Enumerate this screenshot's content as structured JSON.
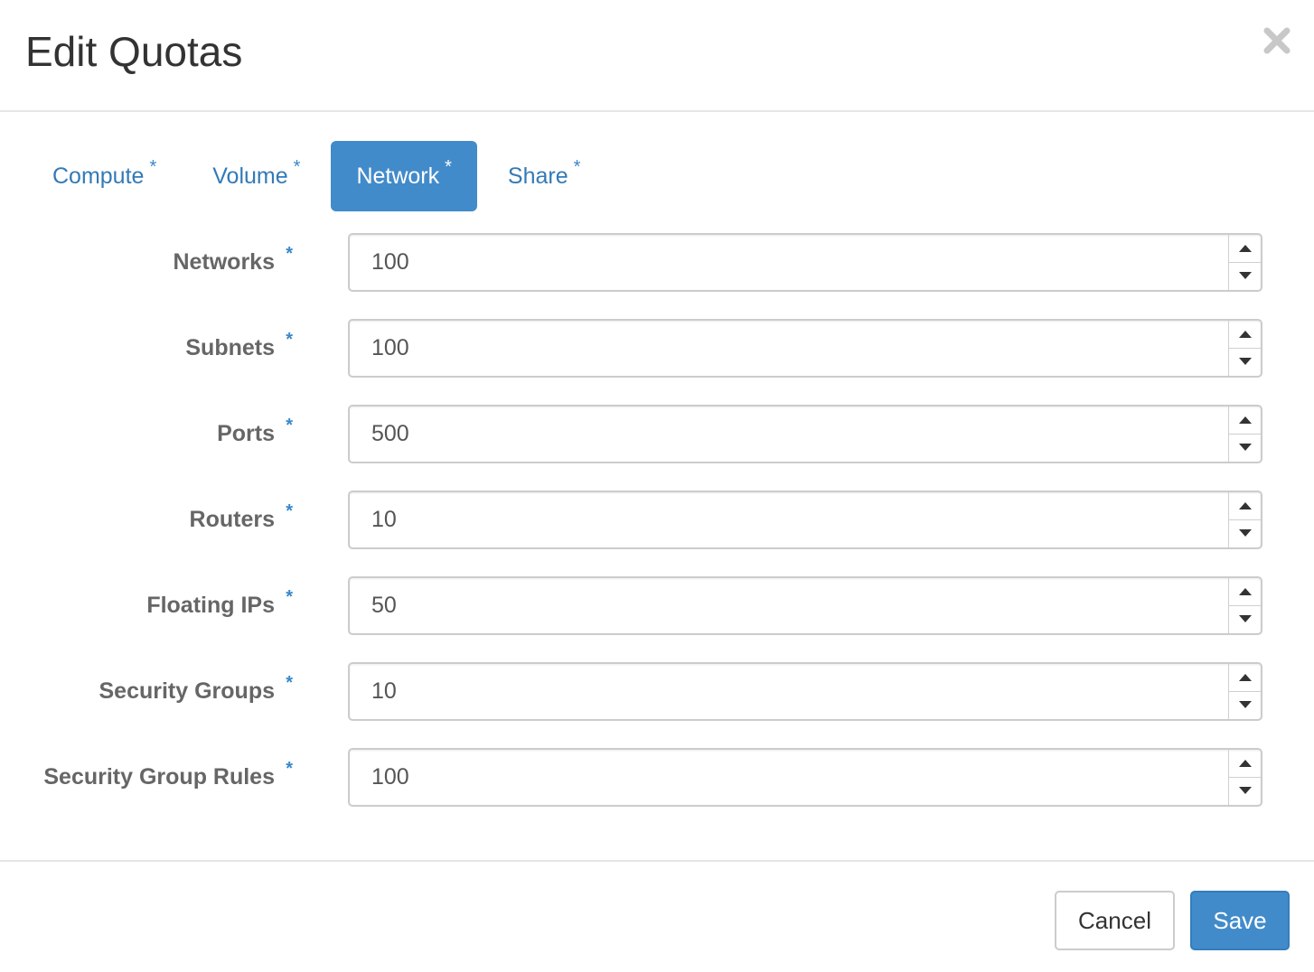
{
  "dialog": {
    "title": "Edit Quotas",
    "close_icon": "close-icon"
  },
  "tabs": [
    {
      "label": "Compute",
      "required_mark": "*",
      "active": false
    },
    {
      "label": "Volume",
      "required_mark": "*",
      "active": false
    },
    {
      "label": "Network",
      "required_mark": "*",
      "active": true
    },
    {
      "label": "Share",
      "required_mark": "*",
      "active": false
    }
  ],
  "fields": [
    {
      "label": "Networks",
      "required_mark": "*",
      "value": "100"
    },
    {
      "label": "Subnets",
      "required_mark": "*",
      "value": "100"
    },
    {
      "label": "Ports",
      "required_mark": "*",
      "value": "500"
    },
    {
      "label": "Routers",
      "required_mark": "*",
      "value": "10"
    },
    {
      "label": "Floating IPs",
      "required_mark": "*",
      "value": "50"
    },
    {
      "label": "Security Groups",
      "required_mark": "*",
      "value": "10"
    },
    {
      "label": "Security Group Rules",
      "required_mark": "*",
      "value": "100"
    }
  ],
  "footer": {
    "cancel_label": "Cancel",
    "save_label": "Save"
  },
  "colors": {
    "accent": "#428bca",
    "link": "#337ab7",
    "label_text": "#666666"
  }
}
